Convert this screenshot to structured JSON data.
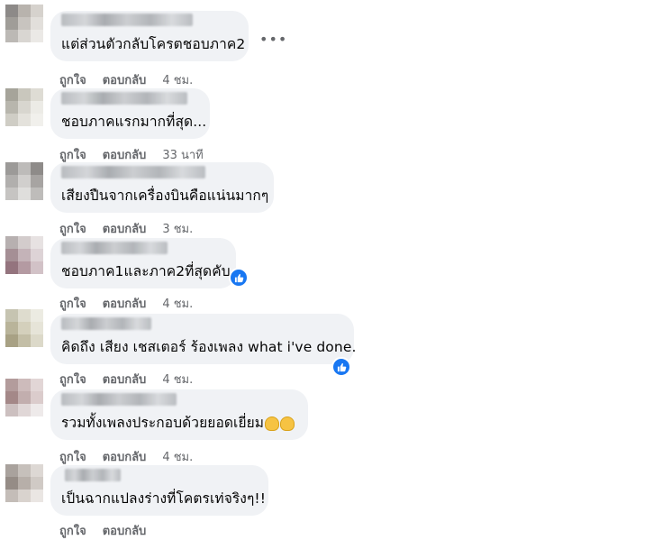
{
  "comments": [
    {
      "text": "แต่ส่วนตัวกลับโครตชอบภาค2",
      "like": "ถูกใจ",
      "reply": "ตอบกลับ",
      "time": "4 ชม."
    },
    {
      "text": "ชอบภาคแรกมากที่สุด...",
      "like": "ถูกใจ",
      "reply": "ตอบกลับ",
      "time": "33 นาที"
    },
    {
      "text": "เสียงปืนจากเครื่องบินคือแน่นมากๆ",
      "like": "ถูกใจ",
      "reply": "ตอบกลับ",
      "time": "3 ชม."
    },
    {
      "text": "ชอบภาค1และภาค2ที่สุดคับ",
      "like": "ถูกใจ",
      "reply": "ตอบกลับ",
      "time": "4 ชม."
    },
    {
      "text": "คิดถึง เสียง เชสเตอร์ ร้องเพลง what i've done.",
      "like": "ถูกใจ",
      "reply": "ตอบกลับ",
      "time": "4 ชม."
    },
    {
      "text": "รวมทั้งเพลงประกอบด้วยยอดเยี่ยม",
      "like": "ถูกใจ",
      "reply": "ตอบกลับ",
      "time": "4 ชม."
    },
    {
      "text": "เป็นฉากแปลงร่างที่โคตรเท่จริงๆ!!",
      "like": "ถูกใจ",
      "reply": "ตอบกลับ",
      "time": ""
    }
  ],
  "more_label": "•••",
  "colors": {
    "bubble": "#f0f2f5",
    "meta": "#65676b",
    "like_badge": "#1877f2"
  },
  "icons": {
    "reaction": "like-reaction-icon",
    "clap": "clapping-hands-icon",
    "more": "more-options-icon"
  }
}
